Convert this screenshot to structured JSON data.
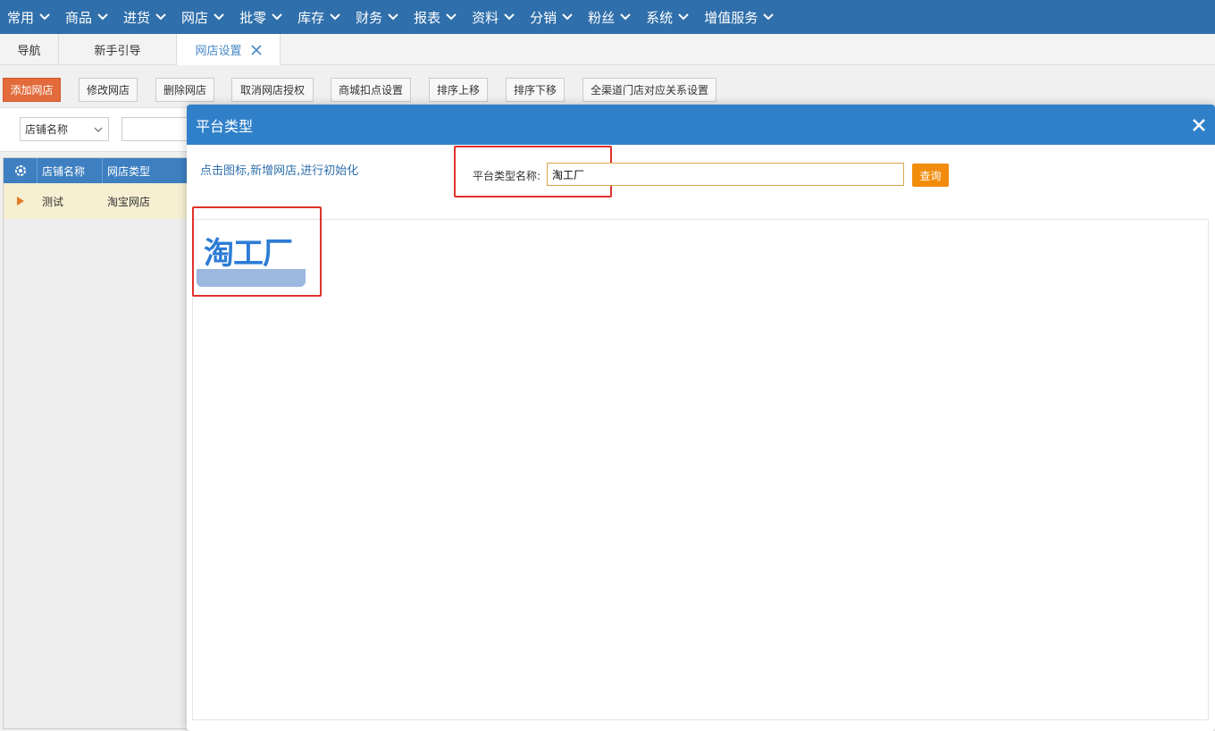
{
  "menu": [
    {
      "label": "常用"
    },
    {
      "label": "商品"
    },
    {
      "label": "进货"
    },
    {
      "label": "网店"
    },
    {
      "label": "批零"
    },
    {
      "label": "库存"
    },
    {
      "label": "财务"
    },
    {
      "label": "报表"
    },
    {
      "label": "资料"
    },
    {
      "label": "分销"
    },
    {
      "label": "粉丝"
    },
    {
      "label": "系统"
    },
    {
      "label": "增值服务"
    }
  ],
  "tabs": [
    {
      "label": "导航"
    },
    {
      "label": "新手引导"
    },
    {
      "label": "网店设置",
      "active": true
    }
  ],
  "toolbar": {
    "add": "添加网店",
    "edit": "修改网店",
    "delete": "删除网店",
    "cancel_auth": "取消网店授权",
    "mall_deduct": "商城扣点设置",
    "move_up": "排序上移",
    "move_down": "排序下移",
    "channel_store": "全渠道门店对应关系设置"
  },
  "filter": {
    "field_selected": "店铺名称",
    "keyword": ""
  },
  "grid": {
    "columns": [
      "店铺名称",
      "网店类型"
    ],
    "rows": [
      [
        "测试",
        "淘宝网店"
      ]
    ]
  },
  "modal": {
    "title": "平台类型",
    "hint": "点击图标,新增网店,进行初始化",
    "platform_label": "平台类型名称:",
    "platform_value": "淘工厂",
    "query_label": "查询",
    "results": [
      {
        "logo_text": "淘工厂"
      }
    ]
  },
  "colors": {
    "menubar": "#2f6fab",
    "modal_header": "#2f80c9",
    "primary_btn": "#e26a3b",
    "query_btn": "#f28c0c",
    "highlight": "#e0312b"
  }
}
